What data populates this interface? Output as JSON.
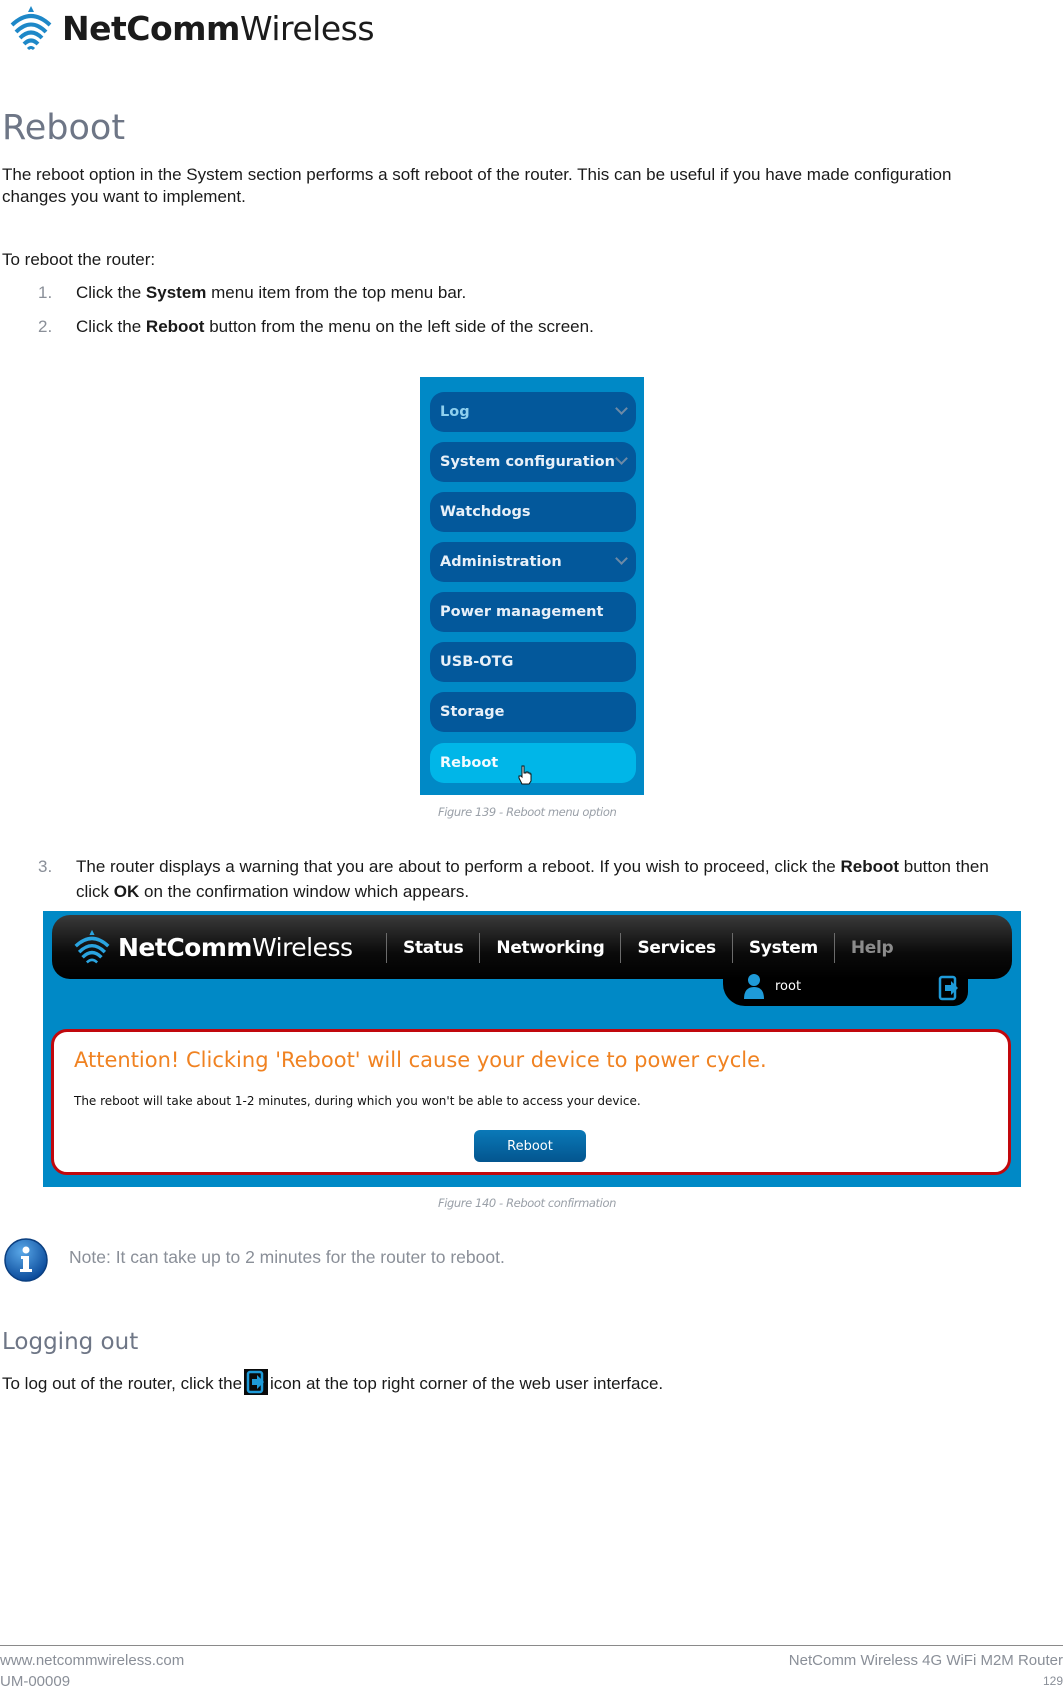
{
  "brand": {
    "name_bold": "NetComm",
    "name_light": "Wireless"
  },
  "section_reboot": {
    "heading": "Reboot",
    "intro_line1": "The reboot option in the System section performs a soft reboot of the router. This can be useful if you have made configuration",
    "intro_line2": "changes you want to implement.",
    "lead": "To reboot the router:",
    "steps": [
      {
        "num": "1.",
        "pre": "Click the ",
        "bold": "System",
        "post": " menu item from the top menu bar."
      },
      {
        "num": "2.",
        "pre": "Click the ",
        "bold": "Reboot",
        "post": " button from the menu on the left side of the screen."
      },
      {
        "num": "3.",
        "pre": "The router displays a warning that you are about to perform a reboot. If you wish to proceed, click the ",
        "bold": "Reboot",
        "post": " button then",
        "line2_pre": "click ",
        "line2_bold": "OK",
        "line2_post": " on the confirmation window which appears."
      }
    ]
  },
  "figure_139": {
    "caption": "Figure 139 - Reboot menu option",
    "menu_items": [
      {
        "label": "Log",
        "has_chevron": true
      },
      {
        "label": "System configuration",
        "has_chevron": true
      },
      {
        "label": "Watchdogs",
        "has_chevron": false
      },
      {
        "label": "Administration",
        "has_chevron": true
      },
      {
        "label": "Power management",
        "has_chevron": false
      },
      {
        "label": "USB-OTG",
        "has_chevron": false
      },
      {
        "label": "Storage",
        "has_chevron": false
      },
      {
        "label": "Reboot",
        "has_chevron": false,
        "active": true
      }
    ]
  },
  "figure_140": {
    "caption": "Figure 140 - Reboot confirmation",
    "logo_bold": "NetComm",
    "logo_light": "Wireless",
    "nav": [
      "Status",
      "Networking",
      "Services",
      "System",
      "Help"
    ],
    "user": "root",
    "alert_title": "Attention! Clicking 'Reboot' will cause your device to power cycle.",
    "alert_desc": "The reboot will take about 1-2 minutes, during which you won't be able to access your device.",
    "reboot_button": "Reboot"
  },
  "note": {
    "icon": "info-icon",
    "text": "Note: It can take up to 2 minutes for the router to reboot."
  },
  "section_logout": {
    "heading": "Logging out",
    "text_pre": "To log out of the router, click the ",
    "icon": "logout-icon",
    "text_post": " icon at the top right corner of the web user interface."
  },
  "footer": {
    "website": "www.netcommwireless.com",
    "doc_id": "UM-00009",
    "product": "NetComm Wireless 4G WiFi M2M Router",
    "page": "129"
  },
  "colors": {
    "accent_blue": "#0089c6",
    "menu_item": "#03589b",
    "menu_active": "#00b6e8",
    "alert_orange": "#f08221",
    "alert_border": "#c1080d"
  }
}
